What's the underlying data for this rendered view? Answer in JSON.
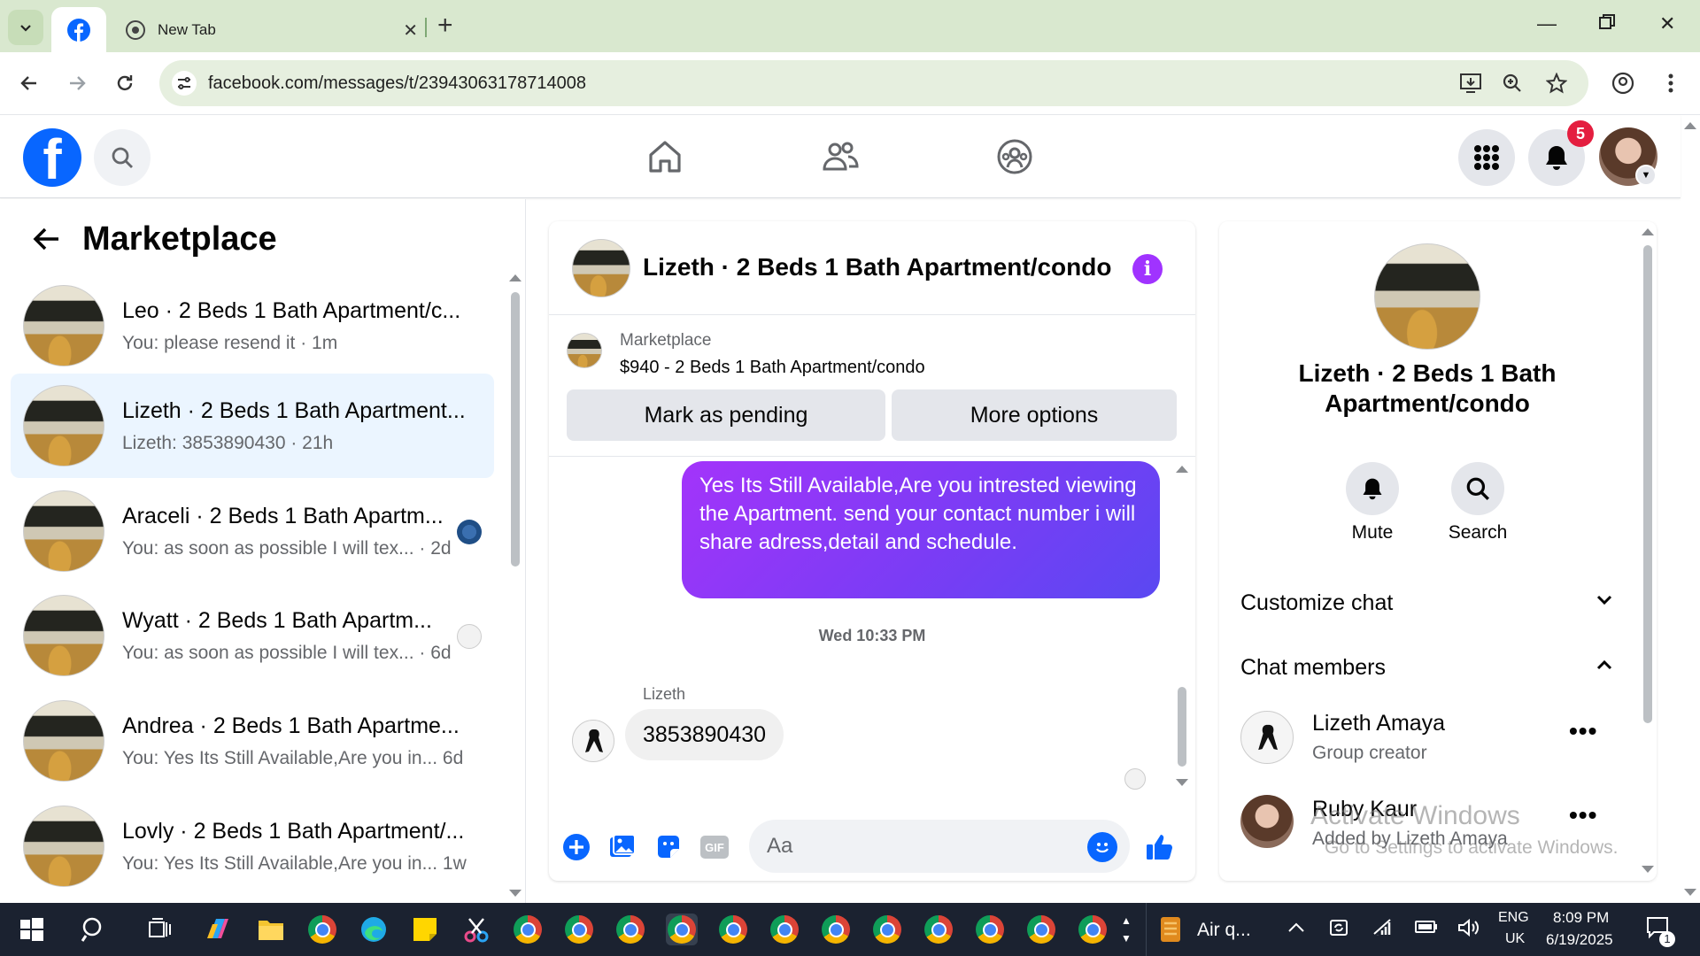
{
  "browser": {
    "tabs": [
      {
        "title": "",
        "icon": "facebook-icon",
        "active": true
      },
      {
        "title": "New Tab",
        "icon": "chrome-icon",
        "active": false
      }
    ],
    "url": "facebook.com/messages/t/23943063178714008"
  },
  "header": {
    "notification_count": "5"
  },
  "left_panel": {
    "title": "Marketplace",
    "conversations": [
      {
        "name": "Leo · 2 Beds 1 Bath Apartment/c...",
        "snippet": "You: please resend it · 1m"
      },
      {
        "name": "Lizeth · 2 Beds 1 Bath Apartment...",
        "snippet": "Lizeth: 3853890430 · 21h"
      },
      {
        "name": "Araceli · 2 Beds 1 Bath Apartm...",
        "snippet": "You: as soon as possible I will tex... · 2d"
      },
      {
        "name": "Wyatt · 2 Beds 1 Bath Apartm...",
        "snippet": "You: as soon as possible I will tex... · 6d"
      },
      {
        "name": "Andrea · 2 Beds 1 Bath Apartme...",
        "snippet": "You: Yes Its Still Available,Are you in...  6d"
      },
      {
        "name": "Lovly · 2 Beds 1 Bath Apartment/...",
        "snippet": "You: Yes Its Still Available,Are you in...  1w"
      }
    ]
  },
  "chat": {
    "title": "Lizeth · 2 Beds 1 Bath Apartment/condo",
    "listing_label": "Marketplace",
    "listing_price": "$940 - 2 Beds 1 Bath Apartment/condo",
    "mark_pending": "Mark as pending",
    "more_options": "More options",
    "outgoing_message": "Yes Its Still Available,Are you intrested viewing the Apartment. send your contact number i will share adress,detail and schedule.",
    "timestamp": "Wed 10:33 PM",
    "sender": "Lizeth",
    "incoming_message": "3853890430",
    "input_placeholder": "Aa",
    "gif_label": "GIF"
  },
  "details": {
    "title": "Lizeth · 2 Beds 1 Bath Apartment/condo",
    "mute_label": "Mute",
    "search_label": "Search",
    "customize_label": "Customize chat",
    "members_label": "Chat members",
    "members": [
      {
        "name": "Lizeth Amaya",
        "role": "Group creator"
      },
      {
        "name": "Ruby Kaur",
        "role": "Added by Lizeth Amaya"
      }
    ]
  },
  "watermark": {
    "line1": "Activate Windows",
    "line2": "Go to Settings to activate Windows."
  },
  "taskbar": {
    "app_label": "Air q...",
    "lang1": "ENG",
    "lang2": "UK",
    "time": "8:09 PM",
    "date": "6/19/2025",
    "notification_count": "1"
  },
  "colors": {
    "fb_blue": "#0866ff",
    "bubble_gradient_start": "#a334fa",
    "bubble_gradient_end": "#5a48f2",
    "active_conv_bg": "#ebf5ff",
    "badge_red": "#e41e3f"
  }
}
